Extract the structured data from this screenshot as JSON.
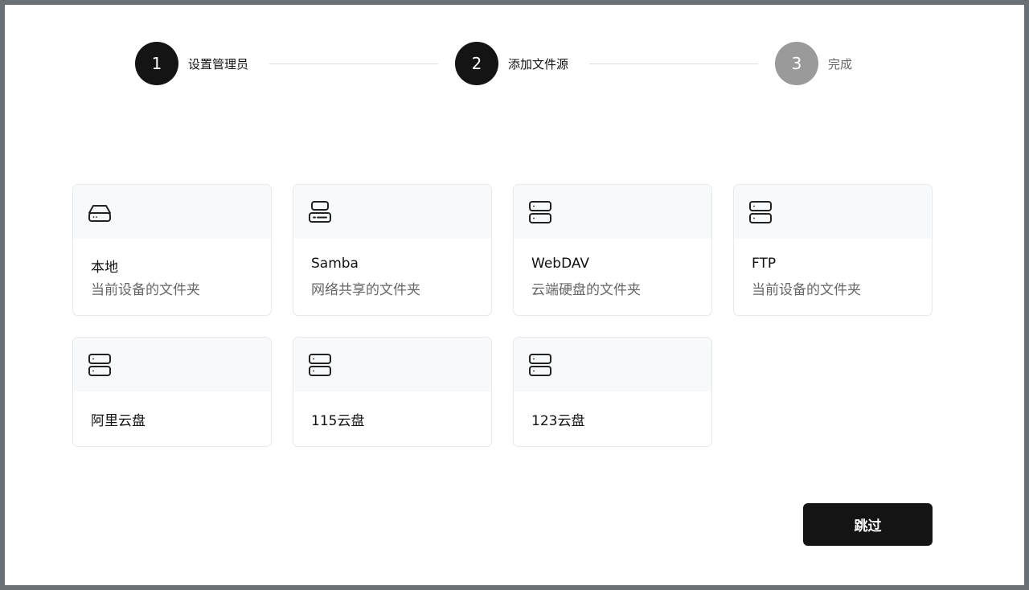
{
  "stepper": {
    "steps": [
      {
        "number": "1",
        "label": "设置管理员",
        "state": "done"
      },
      {
        "number": "2",
        "label": "添加文件源",
        "state": "current"
      },
      {
        "number": "3",
        "label": "完成",
        "state": "pending"
      }
    ]
  },
  "sources": [
    {
      "title": "本地",
      "subtitle": "当前设备的文件夹",
      "icon": "hard-drive-icon"
    },
    {
      "title": "Samba",
      "subtitle": "网络共享的文件夹",
      "icon": "server-icon"
    },
    {
      "title": "WebDAV",
      "subtitle": "云端硬盘的文件夹",
      "icon": "server-icon"
    },
    {
      "title": "FTP",
      "subtitle": "当前设备的文件夹",
      "icon": "server-icon"
    },
    {
      "title": "阿里云盘",
      "icon": "server-icon"
    },
    {
      "title": "115云盘",
      "icon": "server-icon"
    },
    {
      "title": "123云盘",
      "icon": "server-icon"
    }
  ],
  "actions": {
    "skip_label": "跳过"
  },
  "colors": {
    "primary": "#141414",
    "inactive_step": "#9a9a9a",
    "card_head": "#f8f9fb",
    "card_border": "#e6e8ec"
  }
}
